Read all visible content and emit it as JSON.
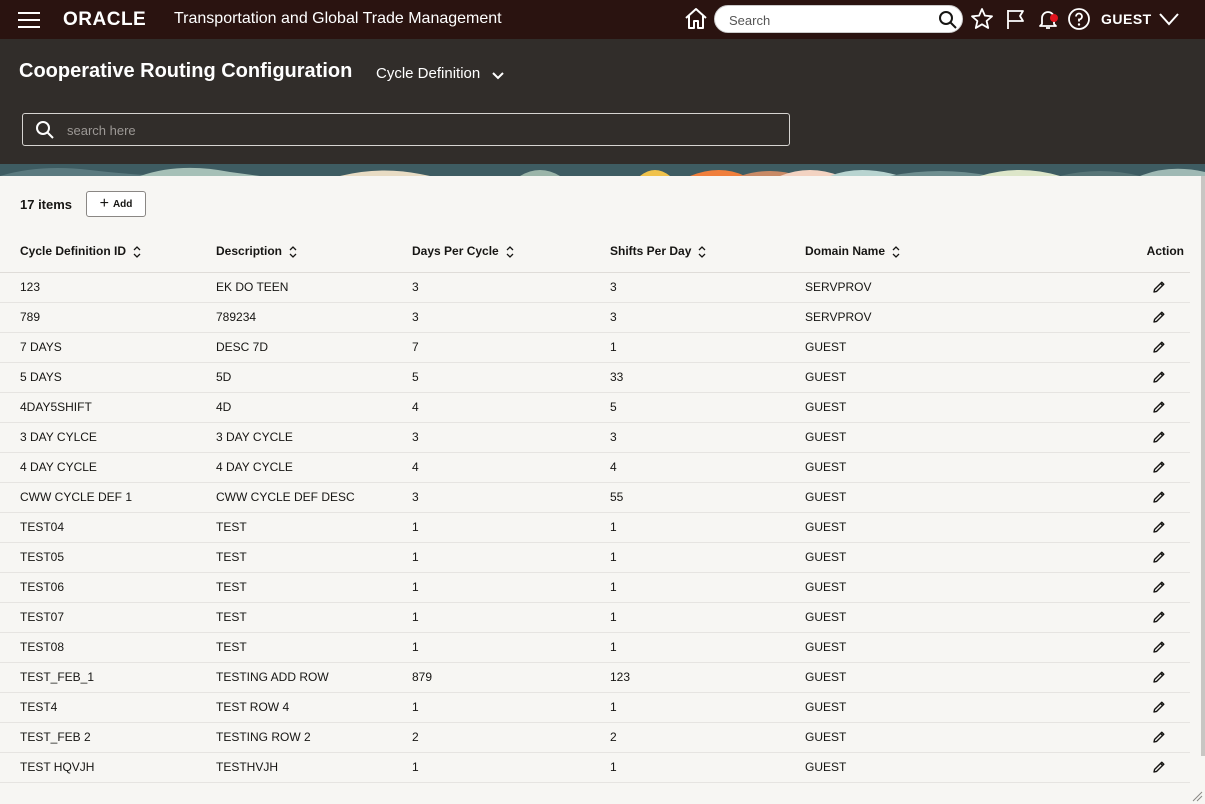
{
  "topbar": {
    "logo": "ORACLE",
    "app_title": "Transportation and Global Trade Management",
    "search_placeholder": "Search",
    "user": "GUEST",
    "notification_color": "#e0141e"
  },
  "header": {
    "title": "Cooperative Routing Configuration",
    "subtitle": "Cycle Definition",
    "search_placeholder": "search here"
  },
  "toolbar": {
    "item_count": "17 items",
    "add_label": "Add"
  },
  "table": {
    "columns": [
      "Cycle Definition ID",
      "Description",
      "Days Per Cycle",
      "Shifts Per Day",
      "Domain Name",
      "Action"
    ],
    "rows": [
      [
        "123",
        "EK DO TEEN",
        "3",
        "3",
        "SERVPROV"
      ],
      [
        "789",
        "789234",
        "3",
        "3",
        "SERVPROV"
      ],
      [
        "7 DAYS",
        "DESC 7D",
        "7",
        "1",
        "GUEST"
      ],
      [
        "5 DAYS",
        "5D",
        "5",
        "33",
        "GUEST"
      ],
      [
        "4DAY5SHIFT",
        "4D",
        "4",
        "5",
        "GUEST"
      ],
      [
        "3 DAY CYLCE",
        "3 DAY CYCLE",
        "3",
        "3",
        "GUEST"
      ],
      [
        "4 DAY CYCLE",
        "4 DAY CYCLE",
        "4",
        "4",
        "GUEST"
      ],
      [
        "CWW CYCLE DEF 1",
        "CWW CYCLE DEF DESC",
        "3",
        "55",
        "GUEST"
      ],
      [
        "TEST04",
        "TEST",
        "1",
        "1",
        "GUEST"
      ],
      [
        "TEST05",
        "TEST",
        "1",
        "1",
        "GUEST"
      ],
      [
        "TEST06",
        "TEST",
        "1",
        "1",
        "GUEST"
      ],
      [
        "TEST07",
        "TEST",
        "1",
        "1",
        "GUEST"
      ],
      [
        "TEST08",
        "TEST",
        "1",
        "1",
        "GUEST"
      ],
      [
        "TEST_FEB_1",
        "TESTING ADD ROW",
        "879",
        "123",
        "GUEST"
      ],
      [
        "TEST4",
        "TEST ROW 4",
        "1",
        "1",
        "GUEST"
      ],
      [
        "TEST_FEB 2",
        "TESTING ROW 2",
        "2",
        "2",
        "GUEST"
      ],
      [
        "TEST HQVJH",
        "TESTHVJH",
        "1",
        "1",
        "GUEST"
      ]
    ]
  }
}
